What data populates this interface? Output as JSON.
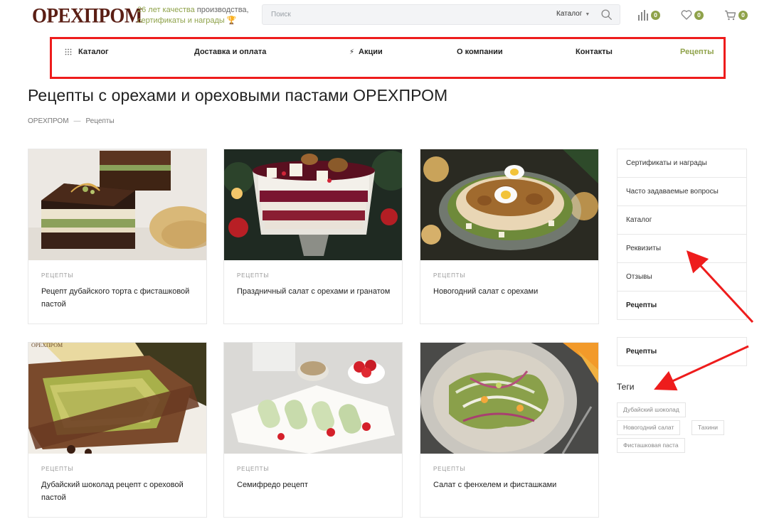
{
  "header": {
    "logo": "ОРЕХПРОМ",
    "tagline_green": "26 лет качества",
    "tagline_rest": " производства,",
    "tagline_line2": "сертификаты и награды",
    "search_placeholder": "Поиск",
    "search_category": "Каталог",
    "compare_count": "0",
    "favorites_count": "0",
    "cart_count": "0"
  },
  "nav": {
    "items": [
      "Каталог",
      "Доставка и оплата",
      "Акции",
      "О компании",
      "Контакты",
      "Рецепты"
    ]
  },
  "page": {
    "title": "Рецепты с орехами и ореховыми пастами ОРЕХПРОМ",
    "breadcrumb": [
      "ОРЕХПРОМ",
      "—",
      "Рецепты"
    ]
  },
  "cards": [
    {
      "category": "РЕЦЕПТЫ",
      "title": "Рецепт дубайского торта с фисташковой пастой"
    },
    {
      "category": "РЕЦЕПТЫ",
      "title": "Праздничный салат с орехами и гранатом"
    },
    {
      "category": "РЕЦЕПТЫ",
      "title": "Новогодний салат с орехами"
    },
    {
      "category": "РЕЦЕПТЫ",
      "title": "Дубайский шоколад рецепт с ореховой пастой"
    },
    {
      "category": "РЕЦЕПТЫ",
      "title": "Семифредо рецепт"
    },
    {
      "category": "РЕЦЕПТЫ",
      "title": "Салат с фенхелем и фисташками"
    }
  ],
  "sidebar": {
    "menu": [
      "Сертификаты и награды",
      "Часто задаваемые вопросы",
      "Каталог",
      "Реквизиты",
      "Отзывы",
      "Рецепты"
    ],
    "box_label": "Рецепты",
    "tags_title": "Теги",
    "tags": [
      "Дубайский шоколад",
      "Новогодний салат",
      "Тахини",
      "Фисташковая паста"
    ]
  },
  "colors": {
    "accent": "#8fa24a",
    "logo": "#5a1e14",
    "annotation": "#ee1c1c"
  }
}
